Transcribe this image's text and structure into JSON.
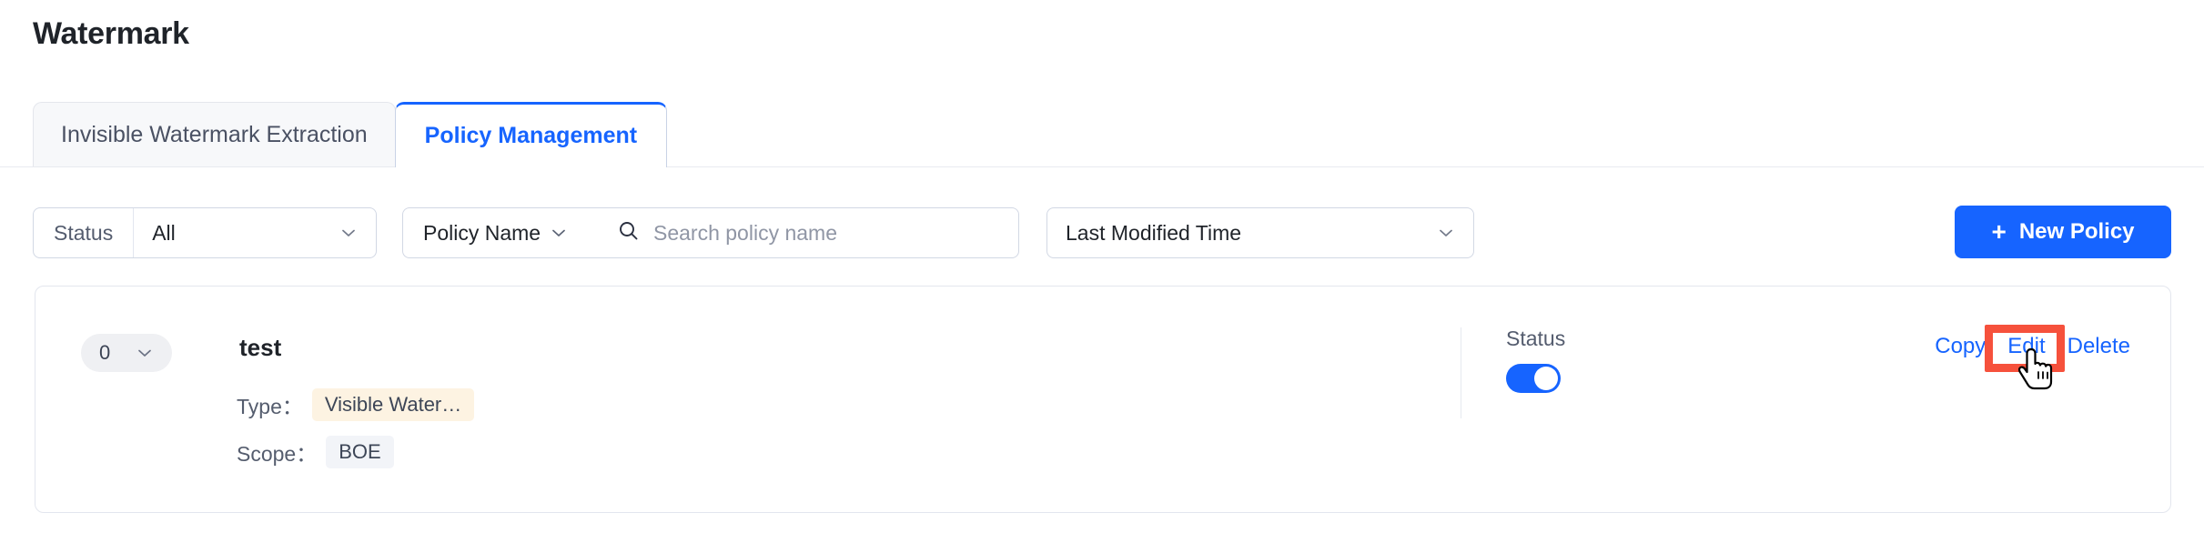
{
  "page": {
    "title": "Watermark"
  },
  "tabs": [
    {
      "label": "Invisible Watermark Extraction",
      "active": false
    },
    {
      "label": "Policy Management",
      "active": true
    }
  ],
  "filters": {
    "status": {
      "label": "Status",
      "value": "All",
      "chevron_icon": "chevron-down-icon"
    },
    "search": {
      "field_label": "Policy Name",
      "field_chevron_icon": "chevron-down-icon",
      "search_icon": "search-icon",
      "value": "",
      "placeholder": "Search policy name"
    },
    "sort": {
      "value": "Last Modified Time",
      "chevron_icon": "chevron-down-icon"
    }
  },
  "toolbar": {
    "new_policy_label": "New Policy",
    "new_policy_icon": "plus-icon"
  },
  "policy_card": {
    "count_badge": {
      "value": "0",
      "chevron_icon": "chevron-down-icon"
    },
    "name": "test",
    "type": {
      "label": "Type：",
      "value": "Visible Water…"
    },
    "scope": {
      "label": "Scope：",
      "value": "BOE"
    },
    "status": {
      "label": "Status",
      "enabled": true
    },
    "actions": [
      {
        "label": "Copy"
      },
      {
        "label": "Edit"
      },
      {
        "label": "Delete"
      }
    ]
  },
  "annotation": {
    "target": "Edit",
    "box_color": "#f6513c",
    "cursor_icon": "pointing-hand-cursor"
  },
  "colors": {
    "accent": "#1664ff",
    "tab_inactive_bg": "#f7f8fa",
    "type_tag_bg": "#fdf3e2",
    "scope_tag_bg": "#f2f4f8",
    "annotation": "#f6513c"
  }
}
